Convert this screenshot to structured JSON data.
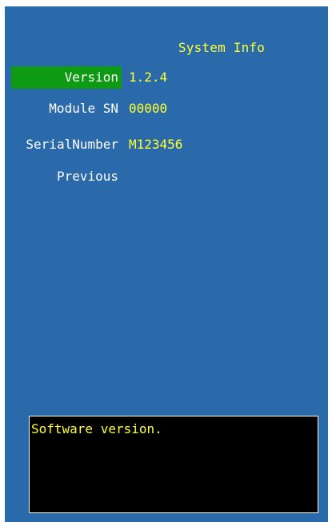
{
  "window": {
    "title": "System Info"
  },
  "colors": {
    "background": "#2b6aaa",
    "selected": "#0e9a12",
    "value_text": "#ffff33",
    "label_text": "#ffffff",
    "help_background": "#000000"
  },
  "menu": {
    "items": [
      {
        "label": "Version",
        "value": "1.2.4",
        "selected": true
      },
      {
        "label": "Module SN",
        "value": "00000",
        "selected": false
      },
      {
        "label": "SerialNumber",
        "value": "M123456",
        "selected": false
      },
      {
        "label": "Previous",
        "value": "",
        "selected": false
      }
    ]
  },
  "help": {
    "text": "Software version."
  }
}
